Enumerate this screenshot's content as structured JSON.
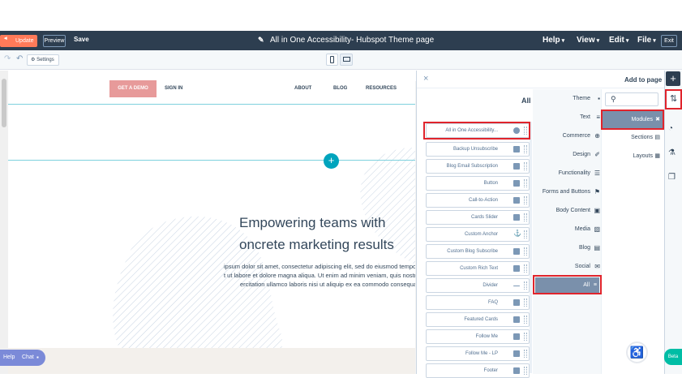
{
  "topbar": {
    "exit": "Exit",
    "menus": [
      "File",
      "Edit",
      "View",
      "Help"
    ],
    "page_title": "All in One Accessibility- Hubspot Theme page",
    "save": "Save",
    "preview": "Preview",
    "update": "Update"
  },
  "toolbar": {
    "settings": "Settings"
  },
  "canvas": {
    "nav": [
      "RESOURCES",
      "BLOG",
      "ABOUT",
      "SIGN IN"
    ],
    "cta": "GET A DEMO",
    "headline_1": "Empowering teams with",
    "headline_2": "oncrete marketing results",
    "body_1": "ipsum dolor sit amet, consectetur adipiscing elit, sed do eiusmod tempor",
    "body_2": "t ut labore et dolore magna aliqua. Ut enim ad minim veniam, quis nostrud",
    "body_3": "ercitation ullamco laboris nisi ut aliquip ex ea commodo consequat.",
    "add_symbol": "+"
  },
  "chat": {
    "help": "Help",
    "chat": "Chat"
  },
  "panel": {
    "title": "Add to page",
    "close": "×",
    "modules_header": "All",
    "nav": [
      "Modules",
      "Sections",
      "Layouts"
    ],
    "categories": [
      "Theme",
      "Text",
      "Commerce",
      "Design",
      "Functionality",
      "Forms and Buttons",
      "Body Content",
      "Media",
      "Blog",
      "Social",
      "All"
    ],
    "modules": [
      "All in One Accessibility...",
      "Backup Unsubscribe",
      "Blog Email Subscription",
      "Button",
      "Call-to-Action",
      "Cards Slider",
      "Custom Anchor",
      "Custom Blog Subscribe",
      "Custom Rich Text",
      "Divider",
      "FAQ",
      "Featured Cards",
      "Follow Me",
      "Follow Me - LP",
      "Footer"
    ]
  },
  "beta": "Beta",
  "colors": {
    "topbar": "#2d3e50",
    "accent": "#ff7a59",
    "teal": "#00a4bd",
    "highlight": "#e0242c",
    "selected": "#7a90ab"
  }
}
